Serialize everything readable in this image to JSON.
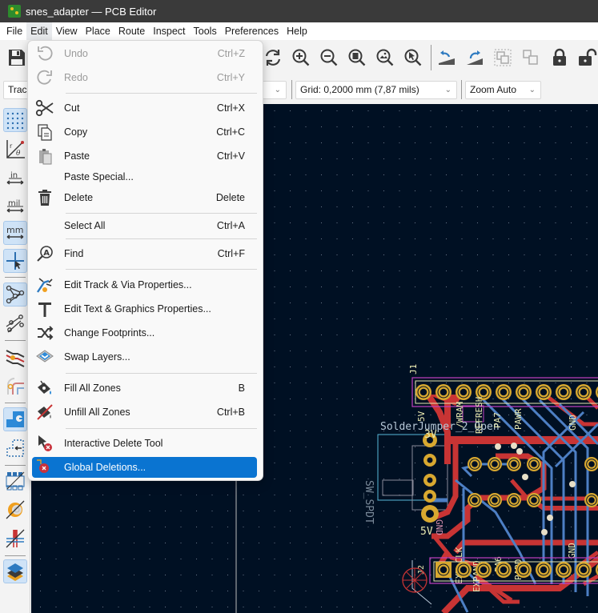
{
  "window": {
    "title": "snes_adapter — PCB Editor"
  },
  "menubar": {
    "items": [
      "File",
      "Edit",
      "View",
      "Place",
      "Route",
      "Inspect",
      "Tools",
      "Preferences",
      "Help"
    ],
    "open_index": 1
  },
  "toolbar": {
    "icons": [
      "save-icon",
      "redraw-icon",
      "zoom-in-icon",
      "zoom-out-icon",
      "zoom-fit-page-icon",
      "zoom-fit-objects-icon",
      "zoom-selection-icon",
      "flip-left-icon",
      "flip-right-icon",
      "group-icon",
      "ungroup-icon",
      "lock-icon",
      "unlock-icon"
    ],
    "track_combo": "Track",
    "grid_combo": "Grid: 0,2000 mm (7,87 mils)",
    "zoom_combo": "Zoom Auto"
  },
  "left_toolbar": {
    "buttons": [
      {
        "name": "grid-toggle",
        "active": true
      },
      {
        "name": "polar-coords",
        "active": false
      },
      {
        "name": "units-inches",
        "active": false
      },
      {
        "name": "units-mils",
        "active": false
      },
      {
        "name": "units-mm",
        "active": true
      },
      {
        "name": "cursor-crosshair",
        "active": true
      },
      {
        "name": "ratsnest",
        "active": true
      },
      {
        "name": "curved-ratsnest",
        "active": false
      },
      {
        "name": "high-contrast-net",
        "active": false
      },
      {
        "name": "net-color-mode",
        "active": false
      },
      {
        "name": "zone-display-filled",
        "active": true
      },
      {
        "name": "zone-display-outline",
        "active": false
      },
      {
        "name": "pad-display-mode",
        "active": false
      },
      {
        "name": "via-display-mode",
        "active": false
      },
      {
        "name": "track-display-mode",
        "active": false
      },
      {
        "name": "layers-manager",
        "active": true
      }
    ]
  },
  "edit_menu": {
    "items": [
      {
        "label": "Undo",
        "shortcut": "Ctrl+Z",
        "icon": "undo-icon",
        "disabled": true
      },
      {
        "label": "Redo",
        "shortcut": "Ctrl+Y",
        "icon": "redo-icon",
        "disabled": true
      },
      {
        "separator": true
      },
      {
        "label": "Cut",
        "shortcut": "Ctrl+X",
        "icon": "scissors-icon"
      },
      {
        "label": "Copy",
        "shortcut": "Ctrl+C",
        "icon": "copy-icon"
      },
      {
        "label": "Paste",
        "shortcut": "Ctrl+V",
        "icon": "paste-icon"
      },
      {
        "label": "Paste Special...",
        "shortcut": "",
        "icon": ""
      },
      {
        "label": "Delete",
        "shortcut": "Delete",
        "icon": "trash-icon"
      },
      {
        "separator": true
      },
      {
        "label": "Select All",
        "shortcut": "Ctrl+A",
        "icon": ""
      },
      {
        "separator": true
      },
      {
        "label": "Find",
        "shortcut": "Ctrl+F",
        "icon": "find-icon"
      },
      {
        "separator": true
      },
      {
        "label": "Edit Track & Via Properties...",
        "shortcut": "",
        "icon": "track-via-properties-icon"
      },
      {
        "label": "Edit Text & Graphics Properties...",
        "shortcut": "",
        "icon": "text-icon"
      },
      {
        "label": "Change Footprints...",
        "shortcut": "",
        "icon": "shuffle-icon"
      },
      {
        "label": "Swap Layers...",
        "shortcut": "",
        "icon": "swap-layers-icon"
      },
      {
        "separator": true
      },
      {
        "label": "Fill All Zones",
        "shortcut": "B",
        "icon": "fill-zones-icon"
      },
      {
        "label": "Unfill All Zones",
        "shortcut": "Ctrl+B",
        "icon": "unfill-zones-icon"
      },
      {
        "separator": true
      },
      {
        "label": "Interactive Delete Tool",
        "shortcut": "",
        "icon": "delete-tool-icon"
      },
      {
        "label": "Global Deletions...",
        "shortcut": "",
        "icon": "global-delete-icon",
        "selected": true
      }
    ]
  },
  "pcb": {
    "top_header_ref": "J1",
    "bottom_header_ref": "J2",
    "silk_texts": [
      "SolderJumper_2_Open",
      "SW_SPDT",
      "3V",
      "5V",
      "GND",
      "5V",
      "/WRAM",
      "REFRESH",
      "PA7",
      "PAWR",
      "GND",
      "EXT CLK",
      "EXPAND",
      "PA6",
      "PARD",
      "GND"
    ],
    "colors": {
      "background": "#001023",
      "grid_dot": "#6b7a8c",
      "front_copper": "#c83434",
      "back_copper": "#4d7fc4",
      "pad": "#d8a830",
      "silkscreen": "#e8e8b0",
      "courtyard": "#c040c0",
      "fab": "#58b8d8",
      "via": "#e8e0c8"
    }
  }
}
